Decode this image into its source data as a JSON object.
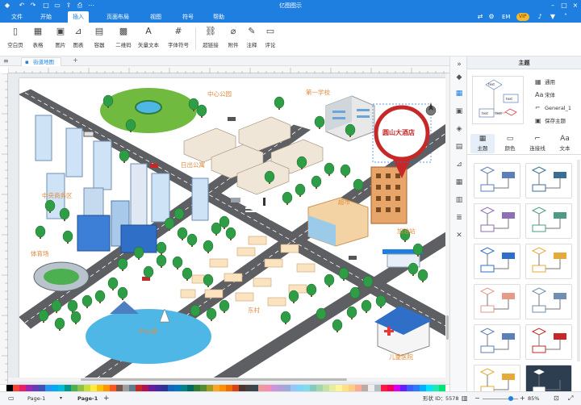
{
  "app": {
    "title": "亿图图示"
  },
  "menu": {
    "tabs": [
      {
        "label": "文件"
      },
      {
        "label": "开始"
      },
      {
        "label": "插入"
      },
      {
        "label": "页面布局"
      },
      {
        "label": "视图"
      },
      {
        "label": "符号"
      },
      {
        "label": "帮助"
      }
    ],
    "active_index": 2,
    "user_badge": "EM",
    "vip_badge": "VIP"
  },
  "ribbon": {
    "buttons": [
      {
        "label": "空白页",
        "icon": "blank-page-icon"
      },
      {
        "label": "表格",
        "icon": "table-icon"
      },
      {
        "label": "图片",
        "icon": "image-icon"
      },
      {
        "label": "图表",
        "icon": "chart-icon"
      },
      {
        "label": "容器",
        "icon": "container-icon"
      },
      {
        "label": "二维码",
        "icon": "qrcode-icon"
      },
      {
        "label": "矢量文本",
        "icon": "vector-text-icon"
      },
      {
        "label": "字体符号",
        "icon": "font-symbol-icon"
      },
      {
        "label": "超链接",
        "icon": "hyperlink-icon"
      },
      {
        "label": "附件",
        "icon": "attachment-icon"
      },
      {
        "label": "注释",
        "icon": "note-icon"
      },
      {
        "label": "评论",
        "icon": "comment-icon"
      }
    ]
  },
  "document": {
    "tab_label": "街道地图"
  },
  "map": {
    "labels": {
      "park": "中心公园",
      "school": "第一学校",
      "hotel": "圆山大酒店",
      "apartment": "日出公寓",
      "business": "中央商务区",
      "supermarket": "超市",
      "gas": "加油站",
      "stadium": "体育场",
      "village": "东村",
      "lake": "中心湖",
      "hospital": "儿童医院"
    }
  },
  "palette": {
    "colors": [
      "#ffffff",
      "#000000",
      "#f44336",
      "#e91e63",
      "#9c27b0",
      "#673ab7",
      "#3f51b5",
      "#2196f3",
      "#03a9f4",
      "#00bcd4",
      "#009688",
      "#4caf50",
      "#8bc34a",
      "#cddc39",
      "#ffeb3b",
      "#ffc107",
      "#ff9800",
      "#ff5722",
      "#795548",
      "#9e9e9e",
      "#607d8b",
      "#c62828",
      "#ad1457",
      "#6a1b9a",
      "#4527a0",
      "#283593",
      "#1565c0",
      "#0277bd",
      "#00838f",
      "#00695c",
      "#2e7d32",
      "#558b2f",
      "#9e9d24",
      "#f9a825",
      "#ff8f00",
      "#ef6c00",
      "#d84315",
      "#4e342e",
      "#424242",
      "#37474f",
      "#ef9a9a",
      "#f48fb1",
      "#ce93d8",
      "#b39ddb",
      "#9fa8da",
      "#90caf9",
      "#81d4fa",
      "#80deea",
      "#80cbc4",
      "#a5d6a7",
      "#c5e1a5",
      "#e6ee9c",
      "#fff59d",
      "#ffe082",
      "#ffcc80",
      "#ffab91",
      "#bcaaa4",
      "#eeeeee",
      "#b0bec5",
      "#ff1744",
      "#f50057",
      "#d500f9",
      "#651fff",
      "#3d5afe",
      "#2979ff",
      "#00b0ff",
      "#00e5ff",
      "#1de9b6",
      "#00e676",
      "#76ff03"
    ]
  },
  "status": {
    "page_selector": "Page-1",
    "page_tab": "Page-1",
    "shape_id_label": "形状 ID：",
    "shape_id": "5578",
    "zoom": "85%"
  },
  "panel": {
    "title": "主题",
    "options": [
      {
        "label": "通用",
        "icon": "grid-icon"
      },
      {
        "label": "宋体",
        "icon": "font-icon"
      },
      {
        "label": "General_1",
        "icon": "connector-icon"
      },
      {
        "label": "保存主题",
        "icon": "save-icon"
      }
    ],
    "tabs": [
      {
        "label": "主题",
        "icon": "theme-icon"
      },
      {
        "label": "颜色",
        "icon": "color-icon"
      },
      {
        "label": "连接线",
        "icon": "connector-line-icon"
      },
      {
        "label": "文本",
        "icon": "text-icon"
      }
    ],
    "preview_texts": [
      "text",
      "text",
      "text",
      "text"
    ]
  }
}
